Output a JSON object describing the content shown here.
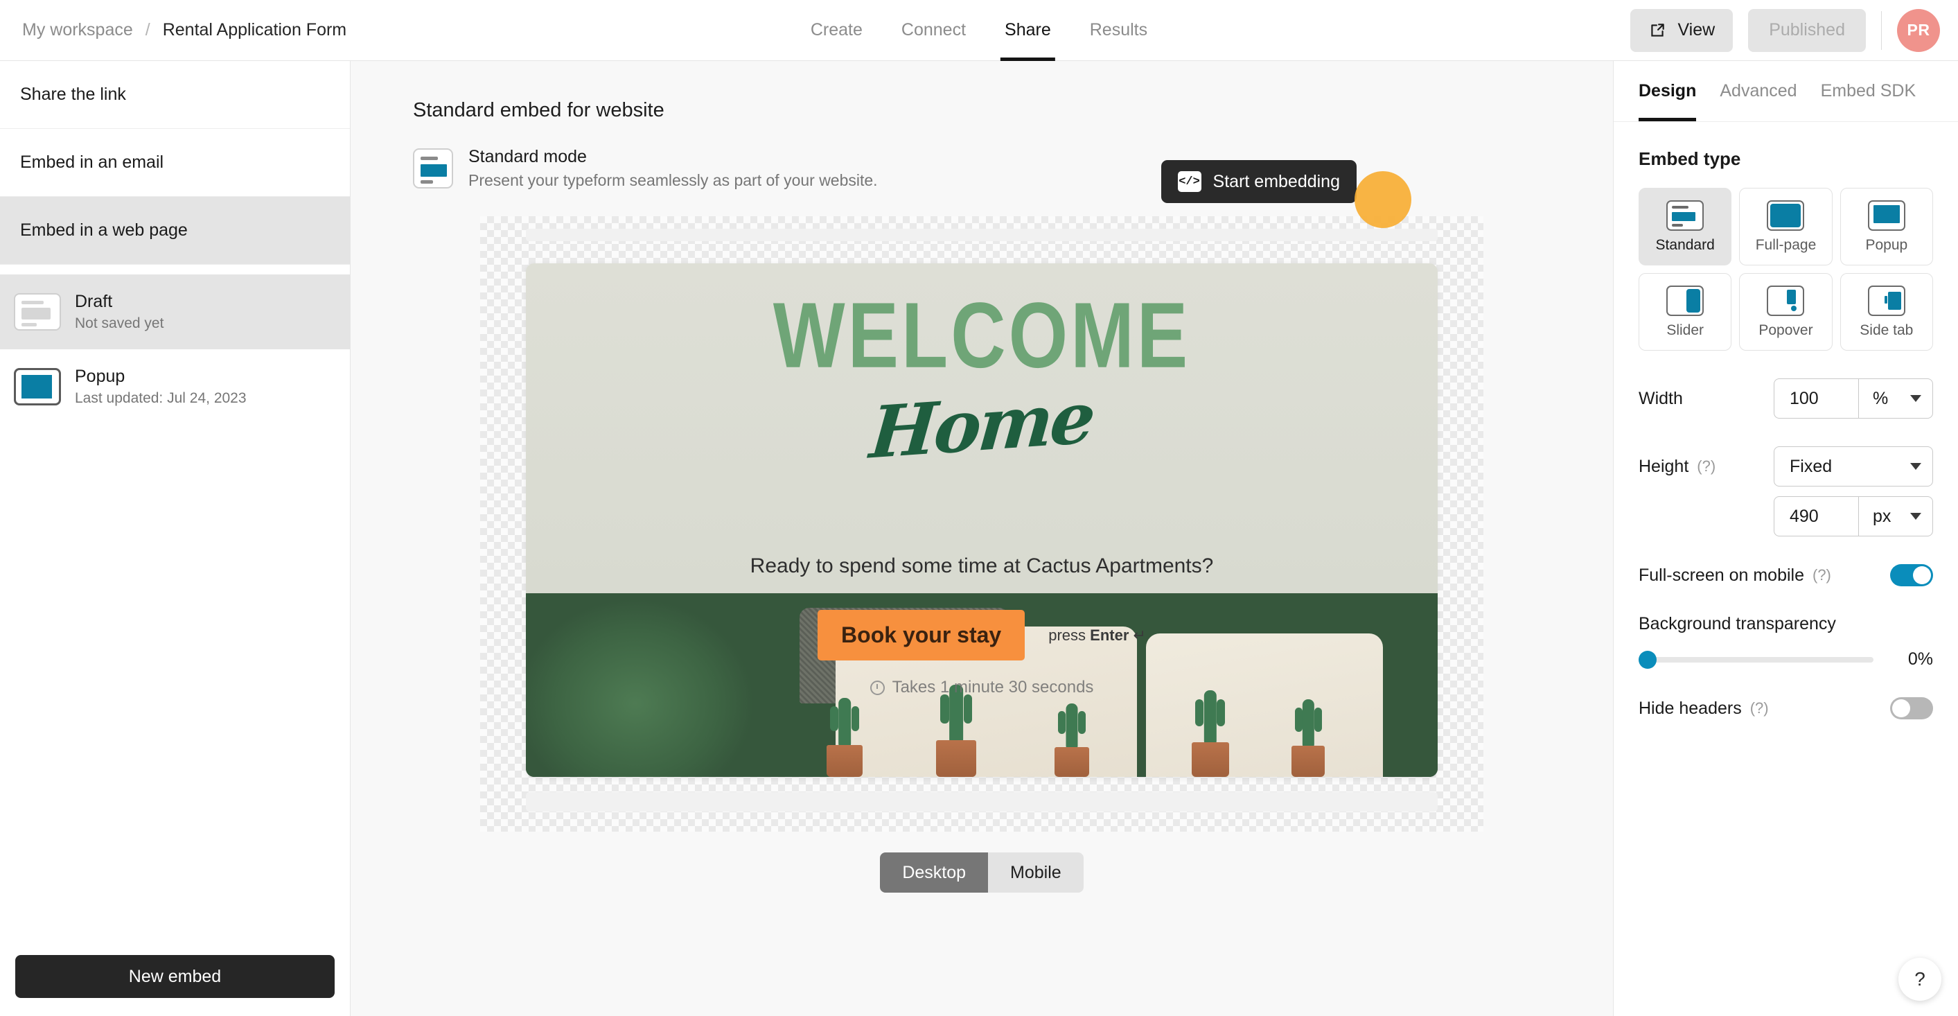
{
  "header": {
    "breadcrumb": {
      "workspace": "My workspace",
      "separator": "/",
      "form_title": "Rental Application Form"
    },
    "tabs": [
      {
        "label": "Create",
        "active": false
      },
      {
        "label": "Connect",
        "active": false
      },
      {
        "label": "Share",
        "active": true
      },
      {
        "label": "Results",
        "active": false
      }
    ],
    "view_button": "View",
    "view_icon": "external-link-icon",
    "published_button": "Published",
    "avatar_initials": "PR"
  },
  "sidebar": {
    "nav": [
      {
        "label": "Share the link",
        "selected": false
      },
      {
        "label": "Embed in an email",
        "selected": false
      },
      {
        "label": "Embed in a web page",
        "selected": true
      }
    ],
    "embeds": [
      {
        "name": "Draft",
        "sub": "Not saved yet",
        "selected": true
      },
      {
        "name": "Popup",
        "sub": "Last updated: Jul 24, 2023",
        "selected": false
      }
    ],
    "new_embed_button": "New embed"
  },
  "main": {
    "title": "Standard embed for website",
    "mode": {
      "name": "Standard mode",
      "description": "Present your typeform seamlessly as part of your website."
    },
    "start_embedding_button": "Start embedding",
    "start_embedding_icon": "code-icon",
    "preview": {
      "welcome_line1": "WELCOME",
      "welcome_line2": "Home",
      "question": "Ready to spend some time at Cactus Apartments?",
      "cta_button": "Book your stay",
      "enter_hint_prefix": "press ",
      "enter_hint_key": "Enter",
      "enter_hint_arrow": "↵",
      "takes_text": "Takes 1 minute 30 seconds",
      "clock_icon": "clock-icon"
    },
    "device_toggle": [
      {
        "label": "Desktop",
        "active": true
      },
      {
        "label": "Mobile",
        "active": false
      }
    ]
  },
  "right_panel": {
    "tabs": [
      {
        "label": "Design",
        "active": true
      },
      {
        "label": "Advanced",
        "active": false
      },
      {
        "label": "Embed SDK",
        "active": false
      }
    ],
    "embed_type_title": "Embed type",
    "embed_types": [
      {
        "label": "Standard",
        "selected": true
      },
      {
        "label": "Full-page",
        "selected": false
      },
      {
        "label": "Popup",
        "selected": false
      },
      {
        "label": "Slider",
        "selected": false
      },
      {
        "label": "Popover",
        "selected": false
      },
      {
        "label": "Side tab",
        "selected": false
      }
    ],
    "width": {
      "label": "Width",
      "value": "100",
      "unit": "%"
    },
    "height": {
      "label": "Height",
      "help": "(?)",
      "mode": "Fixed",
      "value": "490",
      "unit": "px"
    },
    "fullscreen_mobile": {
      "label": "Full-screen on mobile",
      "help": "(?)",
      "on": true
    },
    "background_transparency": {
      "label": "Background transparency",
      "value": "0%"
    },
    "hide_headers": {
      "label": "Hide headers",
      "help": "(?)",
      "on": false
    },
    "help_button": "?"
  },
  "colors": {
    "accent_teal": "#0a7ea4",
    "toggle_on": "#0a8dbb",
    "cta_orange": "#f7903e",
    "click_indicator": "#f7ae34",
    "dark": "#262626"
  }
}
